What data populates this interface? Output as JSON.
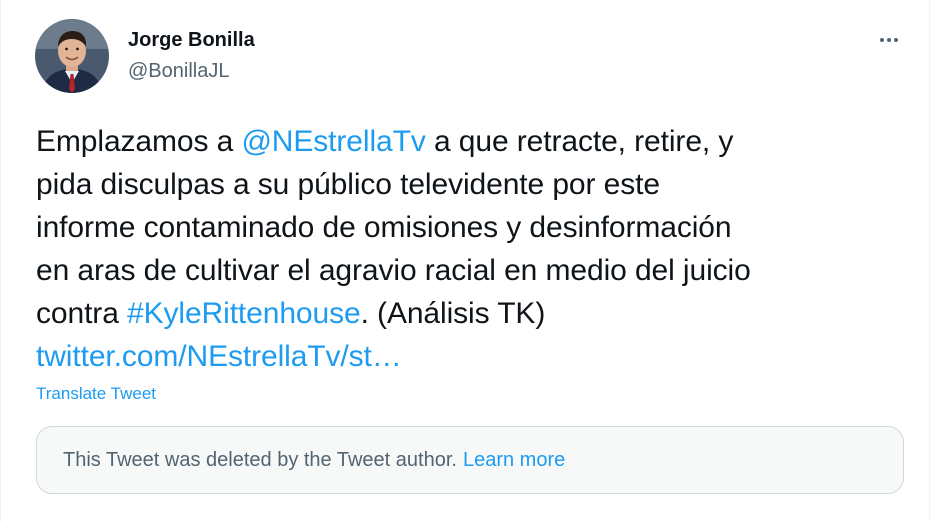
{
  "author": {
    "name": "Jorge Bonilla",
    "handle": "@BonillaJL"
  },
  "tweet": {
    "line1_pre": "Emplazamos a ",
    "mention": "@NEstrellaTv",
    "line1_post": " a que retracte, retire, y",
    "line2": "pida disculpas a su público televidente por este",
    "line3": "informe contaminado de omisiones y desinformación",
    "line4": "en aras de cultivar el agravio racial en medio del juicio",
    "line5_pre": "contra ",
    "hashtag": "#KyleRittenhouse",
    "line5_post": ". (Análisis TK)",
    "url": "twitter.com/NEstrellaTv/st…"
  },
  "translate_label": "Translate Tweet",
  "deleted_notice": {
    "text": "This Tweet was deleted by the Tweet author.",
    "learn_more": "Learn more"
  },
  "icons": {
    "more": "more-horizontal-icon"
  },
  "colors": {
    "link": "#1d9bf0",
    "secondary_text": "#536471",
    "primary_text": "#0f1419",
    "notice_bg": "#f7f9f9"
  }
}
